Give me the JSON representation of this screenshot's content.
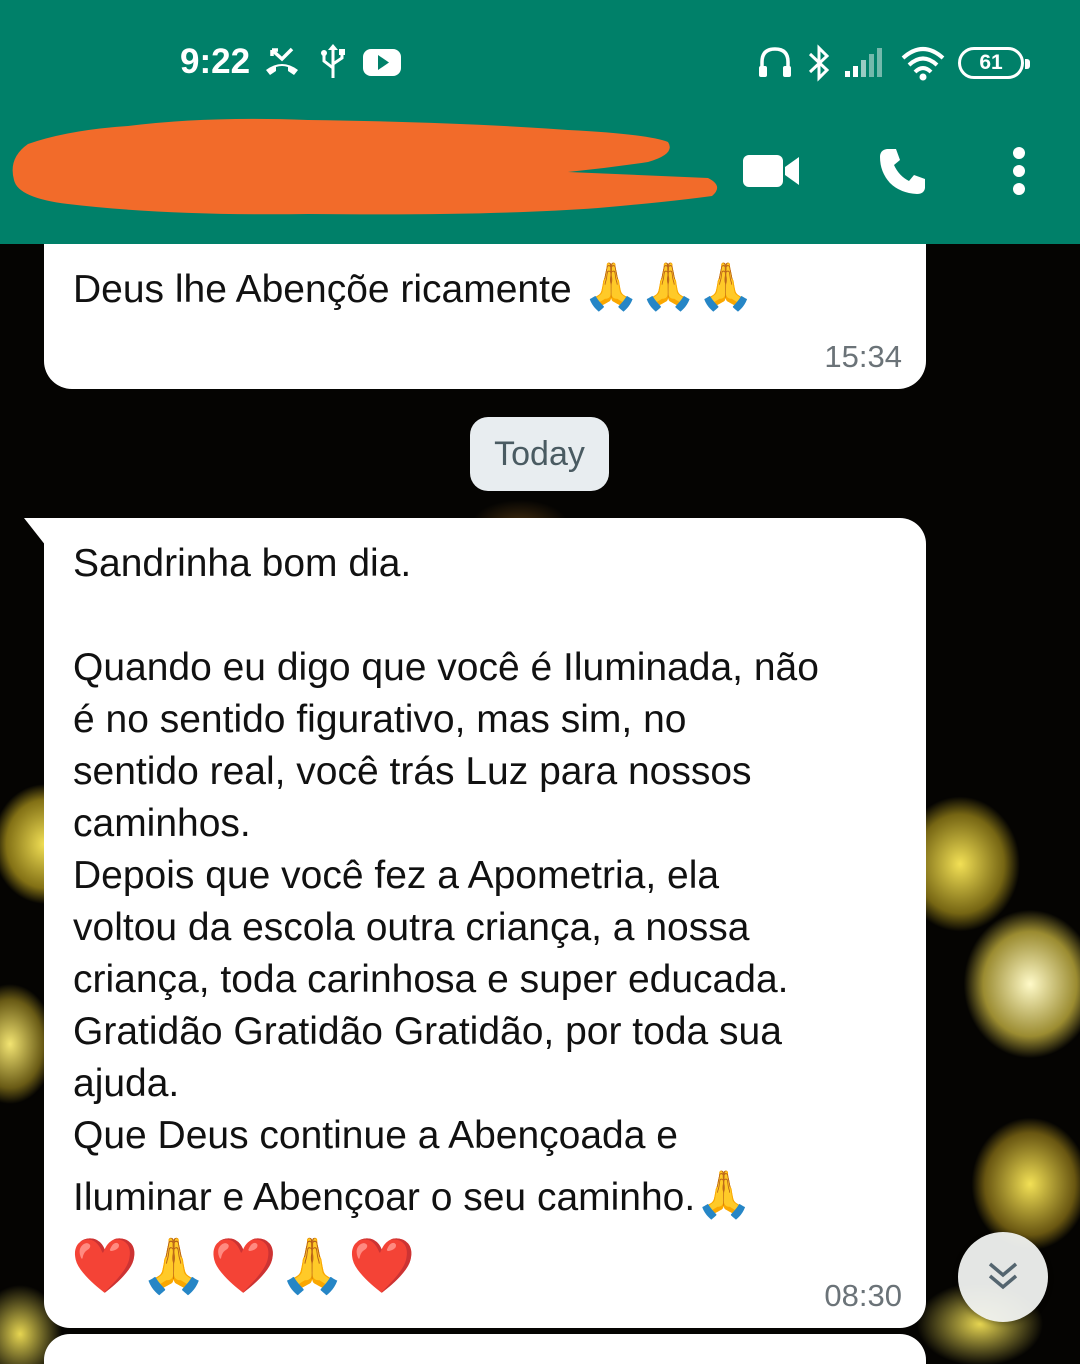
{
  "status_bar": {
    "time": "9:22",
    "battery": "61",
    "icons": [
      "missed-call-icon",
      "usb-icon",
      "youtube-icon",
      "headphones-icon",
      "bluetooth-icon",
      "signal-icon",
      "wifi-icon",
      "battery-icon"
    ]
  },
  "header": {
    "contact_name_redacted": true,
    "redaction_color": "#f26b2a",
    "bar_color": "#008069",
    "actions": [
      "video-call-icon",
      "voice-call-icon",
      "more-options-icon"
    ]
  },
  "messages": [
    {
      "text": "Deus lhe Abençõe ricamente",
      "emoji": "🙏🙏🙏",
      "time": "15:34"
    },
    {
      "lines": [
        "Sandrinha bom dia.",
        "",
        "Quando eu digo que você é Iluminada, não",
        "é no sentido figurativo, mas sim, no",
        "sentido real, você trás Luz para nossos",
        "caminhos.",
        "Depois que você fez a Apometria, ela",
        "voltou da escola outra criança, a nossa",
        "criança,  toda carinhosa e super educada.",
        "Gratidão Gratidão Gratidão, por toda sua",
        "ajuda.",
        "Que Deus continue a Abençoada e",
        "Iluminar e Abençoar o seu caminho."
      ],
      "line_end_emoji": "🙏",
      "emojis": "❤️🙏❤️🙏❤️",
      "time": "08:30"
    }
  ],
  "date_chip": "Today",
  "scroll_button": "double-chevron-down-icon"
}
